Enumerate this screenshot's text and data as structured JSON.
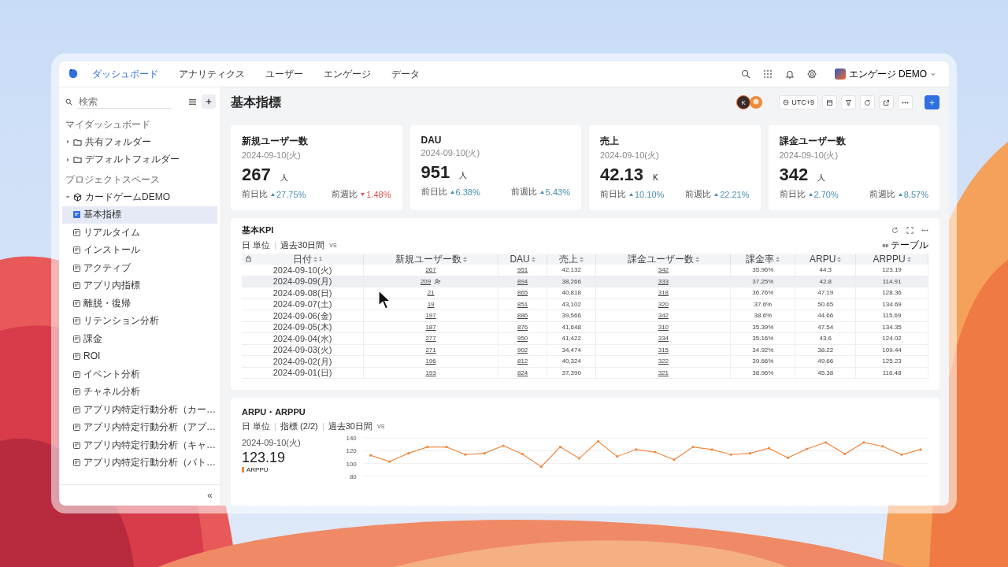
{
  "nav": {
    "tabs": [
      {
        "label": "ダッシュボード",
        "selected": true
      },
      {
        "label": "アナリティクス",
        "selected": false
      },
      {
        "label": "ユーザー",
        "selected": false
      },
      {
        "label": "エンゲージ",
        "selected": false
      },
      {
        "label": "データ",
        "selected": false
      }
    ],
    "user": "エンゲージ DEMO"
  },
  "sidebar": {
    "search_placeholder": "検索",
    "sections": [
      {
        "title": "マイダッシュボード",
        "items": [
          {
            "label": "共有フォルダー",
            "kind": "folder",
            "expanded": false
          },
          {
            "label": "デフォルトフォルダー",
            "kind": "folder",
            "expanded": false
          }
        ]
      },
      {
        "title": "プロジェクトスペース",
        "items": [
          {
            "label": "カードゲームDEMO",
            "kind": "project",
            "expanded": true,
            "children": [
              {
                "label": "基本指標",
                "selected": true
              },
              {
                "label": "リアルタイム",
                "selected": false
              },
              {
                "label": "インストール",
                "selected": false
              },
              {
                "label": "アクティブ",
                "selected": false
              },
              {
                "label": "アプリ内指標",
                "selected": false
              },
              {
                "label": "離脱・復帰",
                "selected": false
              },
              {
                "label": "リテンション分析",
                "selected": false
              },
              {
                "label": "課金",
                "selected": false
              },
              {
                "label": "ROI",
                "selected": false
              },
              {
                "label": "イベント分析",
                "selected": false
              },
              {
                "label": "チャネル分析",
                "selected": false
              },
              {
                "label": "アプリ内特定行動分析（カー…",
                "selected": false
              },
              {
                "label": "アプリ内特定行動分析（アプ…",
                "selected": false
              },
              {
                "label": "アプリ内特定行動分析（キャ…",
                "selected": false
              },
              {
                "label": "アプリ内特定行動分析（バト…",
                "selected": false
              }
            ]
          }
        ]
      }
    ],
    "collapse": "«"
  },
  "page": {
    "title": "基本指標",
    "avatar": "K",
    "timezone": "UTC+9"
  },
  "kpis": [
    {
      "title": "新規ユーザー数",
      "date": "2024-09-10(火)",
      "value": "267",
      "unit": "人",
      "comparisons": [
        {
          "label": "前日比",
          "value": "27.75%",
          "increase": true
        },
        {
          "label": "前週比",
          "value": "1.48%",
          "increase": false
        }
      ]
    },
    {
      "title": "DAU",
      "date": "2024-09-10(火)",
      "value": "951",
      "unit": "人",
      "comparisons": [
        {
          "label": "前日比",
          "value": "6.38%",
          "increase": true
        },
        {
          "label": "前週比",
          "value": "5.43%",
          "increase": true
        }
      ]
    },
    {
      "title": "売上",
      "date": "2024-09-10(火)",
      "value": "42.13",
      "unit": "K",
      "comparisons": [
        {
          "label": "前日比",
          "value": "10.10%",
          "increase": true
        },
        {
          "label": "前週比",
          "value": "22.21%",
          "increase": true
        }
      ]
    },
    {
      "title": "課金ユーザー数",
      "date": "2024-09-10(火)",
      "value": "342",
      "unit": "人",
      "comparisons": [
        {
          "label": "前日比",
          "value": "2.70%",
          "increase": true
        },
        {
          "label": "前週比",
          "value": "8.57%",
          "increase": true
        }
      ]
    }
  ],
  "table_panel": {
    "title": "基本KPI",
    "filters": [
      "日 単位",
      "過去30日間"
    ],
    "vs": "VS",
    "view": "テーブル",
    "columns": [
      {
        "label": "日付",
        "kind": "text",
        "sort_order": "1"
      },
      {
        "label": "新規ユーザー数",
        "kind": "link"
      },
      {
        "label": "DAU",
        "kind": "link"
      },
      {
        "label": "売上",
        "kind": "text"
      },
      {
        "label": "課金ユーザー数",
        "kind": "link"
      },
      {
        "label": "課金率",
        "kind": "text"
      },
      {
        "label": "ARPU",
        "kind": "text"
      },
      {
        "label": "ARPPU",
        "kind": "text"
      }
    ],
    "rows": [
      {
        "hovered": false,
        "cells": [
          "2024-09-10(火)",
          "267",
          "951",
          "42,132",
          "342",
          "35.96%",
          "44.3",
          "123.19"
        ]
      },
      {
        "hovered": true,
        "cells": [
          "2024-09-09(月)",
          "209",
          "894",
          "38,266",
          "333",
          "37.25%",
          "42.8",
          "114.91"
        ]
      },
      {
        "hovered": false,
        "cells": [
          "2024-09-08(日)",
          "21",
          "865",
          "40,818",
          "318",
          "36.76%",
          "47.19",
          "128.36"
        ]
      },
      {
        "hovered": false,
        "cells": [
          "2024-09-07(土)",
          "19",
          "851",
          "43,102",
          "320",
          "37.6%",
          "50.65",
          "134.69"
        ]
      },
      {
        "hovered": false,
        "cells": [
          "2024-09-06(金)",
          "197",
          "886",
          "39,566",
          "342",
          "38.6%",
          "44.66",
          "115.69"
        ]
      },
      {
        "hovered": false,
        "cells": [
          "2024-09-05(木)",
          "187",
          "876",
          "41,648",
          "310",
          "35.39%",
          "47.54",
          "134.35"
        ]
      },
      {
        "hovered": false,
        "cells": [
          "2024-09-04(水)",
          "277",
          "950",
          "41,422",
          "334",
          "35.16%",
          "43.6",
          "124.02"
        ]
      },
      {
        "hovered": false,
        "cells": [
          "2024-09-03(火)",
          "271",
          "902",
          "34,474",
          "315",
          "34.92%",
          "38.22",
          "109.44"
        ]
      },
      {
        "hovered": false,
        "cells": [
          "2024-09-02(月)",
          "196",
          "812",
          "40,324",
          "322",
          "39.66%",
          "49.66",
          "125.23"
        ]
      },
      {
        "hovered": false,
        "cells": [
          "2024-09-01(日)",
          "193",
          "824",
          "37,390",
          "321",
          "38.96%",
          "45.38",
          "116.48"
        ]
      }
    ]
  },
  "chart_panel": {
    "title": "ARPU・ARPPU",
    "filters": [
      "日 単位",
      "指標 (2/2)",
      "過去30日間"
    ],
    "vs": "VS",
    "summary": {
      "date": "2024-09-10(火)",
      "value": "123.19"
    },
    "chart_data": {
      "type": "line",
      "ylim": [
        80,
        140
      ],
      "yticks": [
        80,
        100,
        120,
        140
      ],
      "series": [
        {
          "name": "ARPPU",
          "color": "#f0883e",
          "values": [
            113,
            103,
            116,
            126,
            126,
            114,
            116,
            128,
            115,
            95,
            126,
            108,
            135,
            111,
            122,
            118,
            106,
            126,
            122,
            114,
            116,
            124,
            109,
            123,
            133,
            115,
            133,
            127,
            114,
            122
          ]
        }
      ]
    }
  }
}
